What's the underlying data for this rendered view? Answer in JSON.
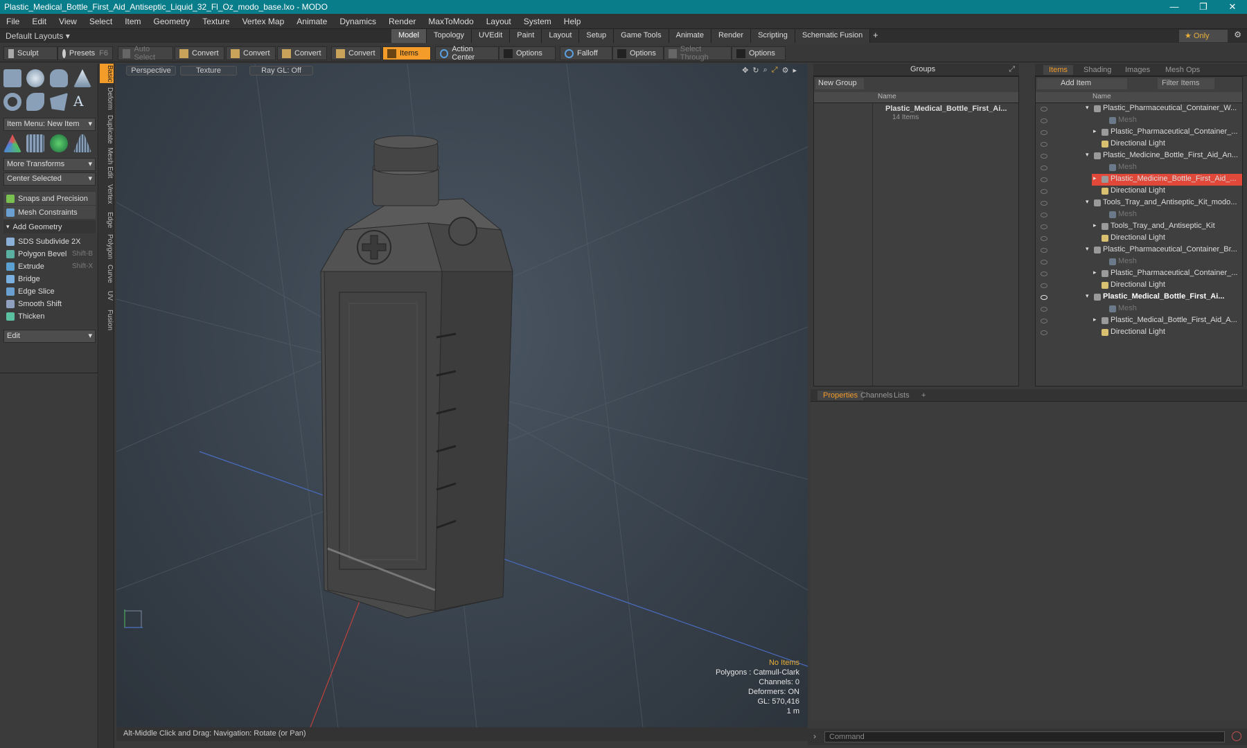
{
  "window": {
    "title": "Plastic_Medical_Bottle_First_Aid_Antiseptic_Liquid_32_Fl_Oz_modo_base.lxo - MODO",
    "minimize": "—",
    "maximize": "❐",
    "close": "✕"
  },
  "menu": [
    "File",
    "Edit",
    "View",
    "Select",
    "Item",
    "Geometry",
    "Texture",
    "Vertex Map",
    "Animate",
    "Dynamics",
    "Render",
    "MaxToModo",
    "Layout",
    "System",
    "Help"
  ],
  "layoutbar": {
    "default_layouts": "Default Layouts ▾",
    "tabs": [
      "Model",
      "Topology",
      "UVEdit",
      "Paint",
      "Layout",
      "Setup",
      "Game Tools",
      "Animate",
      "Render",
      "Scripting",
      "Schematic Fusion"
    ],
    "active_tab": "Model",
    "plus": "+",
    "only": "★ Only",
    "gear": "⚙"
  },
  "toolbar": {
    "sculpt": "Sculpt",
    "presets": "Presets",
    "presets_key": "F6",
    "auto_select": "Auto Select",
    "convert1": "Convert",
    "convert2": "Convert",
    "convert3": "Convert",
    "convert4": "Convert",
    "items": "Items",
    "action_center": "Action Center",
    "options1": "Options",
    "falloff": "Falloff",
    "options2": "Options",
    "select_through": "Select Through",
    "options3": "Options"
  },
  "left": {
    "item_menu": "Item Menu: New Item",
    "more_transforms": "More Transforms",
    "center_selected": "Center Selected",
    "snaps": "Snaps and Precision",
    "mesh_constraints": "Mesh Constraints",
    "add_geometry": "Add Geometry",
    "tools": [
      {
        "label": "SDS Subdivide 2X",
        "key": ""
      },
      {
        "label": "Polygon Bevel",
        "key": "Shift-B"
      },
      {
        "label": "Extrude",
        "key": "Shift-X"
      },
      {
        "label": "Bridge",
        "key": ""
      },
      {
        "label": "Edge Slice",
        "key": ""
      },
      {
        "label": "Smooth Shift",
        "key": ""
      },
      {
        "label": "Thicken",
        "key": ""
      }
    ],
    "edit": "Edit",
    "vtabs": [
      "Basic",
      "Deform",
      "Duplicate",
      "Mesh Edit",
      "Vertex",
      "Edge",
      "Polygon",
      "Curve",
      "UV",
      "Fusion"
    ]
  },
  "viewport": {
    "perspective": "Perspective",
    "texture": "Texture",
    "raygl": "Ray GL: Off",
    "info": {
      "no_items": "No Items",
      "polygons": "Polygons : Catmull-Clark",
      "channels": "Channels: 0",
      "deformers": "Deformers: ON",
      "gl": "GL: 570,416",
      "scale": "1 m"
    },
    "status": "Alt-Middle Click and Drag:   Navigation: Rotate (or Pan)"
  },
  "groups": {
    "title": "Groups",
    "new_group": "New Group",
    "name_col": "Name",
    "item_name": "Plastic_Medical_Bottle_First_Ai...",
    "item_count": "14 Items"
  },
  "items": {
    "tabs": [
      "Items",
      "Shading",
      "Images",
      "Mesh Ops"
    ],
    "add_item": "Add Item",
    "filter": "Filter Items",
    "name_col": "Name",
    "rows": [
      {
        "label": "Plastic_Pharmaceutical_Container_W...",
        "indent": 0,
        "type": "scene",
        "bold": false,
        "sel": false
      },
      {
        "label": "Mesh",
        "indent": 2,
        "type": "mesh",
        "bold": false,
        "sel": false
      },
      {
        "label": "Plastic_Pharmaceutical_Container_...",
        "indent": 1,
        "type": "group",
        "bold": false,
        "sel": false
      },
      {
        "label": "Directional Light",
        "indent": 1,
        "type": "light",
        "bold": false,
        "sel": false
      },
      {
        "label": "Plastic_Medicine_Bottle_First_Aid_An...",
        "indent": 0,
        "type": "scene",
        "bold": false,
        "sel": false
      },
      {
        "label": "Mesh",
        "indent": 2,
        "type": "mesh",
        "bold": false,
        "sel": false
      },
      {
        "label": "Plastic_Medicine_Bottle_First_Aid_...",
        "indent": 1,
        "type": "group",
        "bold": false,
        "sel": true
      },
      {
        "label": "Directional Light",
        "indent": 1,
        "type": "light",
        "bold": false,
        "sel": false
      },
      {
        "label": "Tools_Tray_and_Antiseptic_Kit_modo...",
        "indent": 0,
        "type": "scene",
        "bold": false,
        "sel": false
      },
      {
        "label": "Mesh",
        "indent": 2,
        "type": "mesh",
        "bold": false,
        "sel": false
      },
      {
        "label": "Tools_Tray_and_Antiseptic_Kit",
        "indent": 1,
        "type": "group",
        "bold": false,
        "sel": false
      },
      {
        "label": "Directional Light",
        "indent": 1,
        "type": "light",
        "bold": false,
        "sel": false
      },
      {
        "label": "Plastic_Pharmaceutical_Container_Br...",
        "indent": 0,
        "type": "scene",
        "bold": false,
        "sel": false
      },
      {
        "label": "Mesh",
        "indent": 2,
        "type": "mesh",
        "bold": false,
        "sel": false
      },
      {
        "label": "Plastic_Pharmaceutical_Container_...",
        "indent": 1,
        "type": "group",
        "bold": false,
        "sel": false
      },
      {
        "label": "Directional Light",
        "indent": 1,
        "type": "light",
        "bold": false,
        "sel": false
      },
      {
        "label": "Plastic_Medical_Bottle_First_Ai...",
        "indent": 0,
        "type": "scene",
        "bold": true,
        "sel": false
      },
      {
        "label": "Mesh",
        "indent": 2,
        "type": "mesh",
        "bold": false,
        "sel": false
      },
      {
        "label": "Plastic_Medical_Bottle_First_Aid_A...",
        "indent": 1,
        "type": "group",
        "bold": false,
        "sel": false
      },
      {
        "label": "Directional Light",
        "indent": 1,
        "type": "light",
        "bold": false,
        "sel": false
      }
    ]
  },
  "props": {
    "tabs": [
      "Properties",
      "Channels",
      "Lists"
    ],
    "plus": "+"
  },
  "command": {
    "placeholder": "Command"
  },
  "colors": {
    "accent": "#f39c2a",
    "titlebar": "#0a7d8a",
    "selection": "#e0483a"
  }
}
